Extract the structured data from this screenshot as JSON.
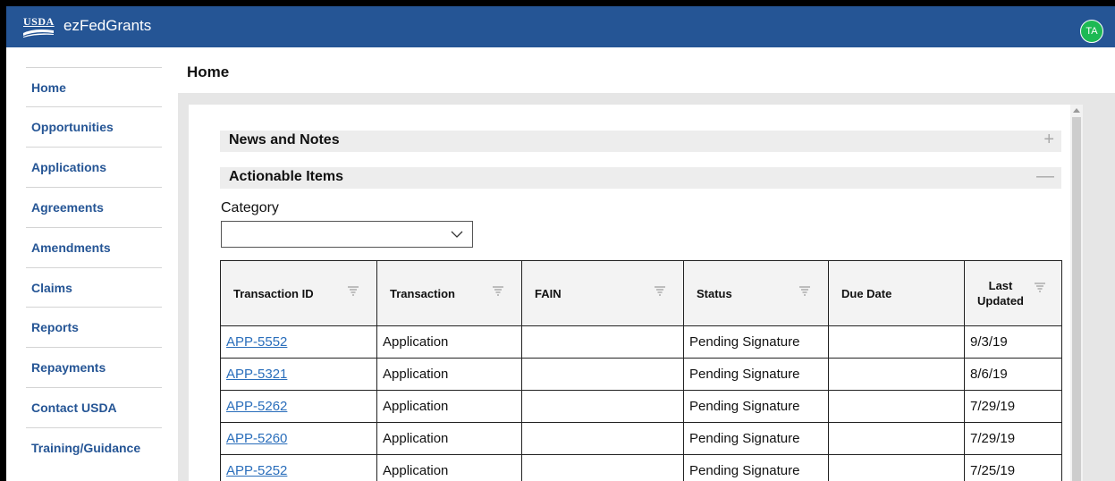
{
  "header": {
    "logo_text": "USDA",
    "app_name": "ezFedGrants",
    "user_initials": "TA"
  },
  "sidebar": {
    "items": [
      {
        "label": "Home"
      },
      {
        "label": "Opportunities"
      },
      {
        "label": "Applications"
      },
      {
        "label": "Agreements"
      },
      {
        "label": "Amendments"
      },
      {
        "label": "Claims"
      },
      {
        "label": "Reports"
      },
      {
        "label": "Repayments"
      },
      {
        "label": "Contact USDA"
      },
      {
        "label": "Training/Guidance"
      }
    ]
  },
  "page": {
    "title": "Home"
  },
  "sections": {
    "news": {
      "title": "News and Notes",
      "toggle": "+"
    },
    "actionable": {
      "title": "Actionable Items",
      "toggle": "—"
    }
  },
  "filter": {
    "label": "Category",
    "value": ""
  },
  "table": {
    "columns": [
      "Transaction ID",
      "Transaction",
      "FAIN",
      "Status",
      "Due Date",
      "Last",
      "Updated"
    ],
    "rows": [
      {
        "id": "APP-5552",
        "transaction": "Application",
        "fain": "",
        "status": "Pending Signature",
        "due": "",
        "updated": "9/3/19"
      },
      {
        "id": "APP-5321",
        "transaction": "Application",
        "fain": "",
        "status": "Pending Signature",
        "due": "",
        "updated": "8/6/19"
      },
      {
        "id": "APP-5262",
        "transaction": "Application",
        "fain": "",
        "status": "Pending Signature",
        "due": "",
        "updated": "7/29/19"
      },
      {
        "id": "APP-5260",
        "transaction": "Application",
        "fain": "",
        "status": "Pending Signature",
        "due": "",
        "updated": "7/29/19"
      },
      {
        "id": "APP-5252",
        "transaction": "Application",
        "fain": "",
        "status": "Pending Signature",
        "due": "",
        "updated": "7/25/19"
      }
    ]
  },
  "colors": {
    "brand_blue": "#255595",
    "avatar_green": "#1db954",
    "link_blue": "#2a6ebb"
  }
}
